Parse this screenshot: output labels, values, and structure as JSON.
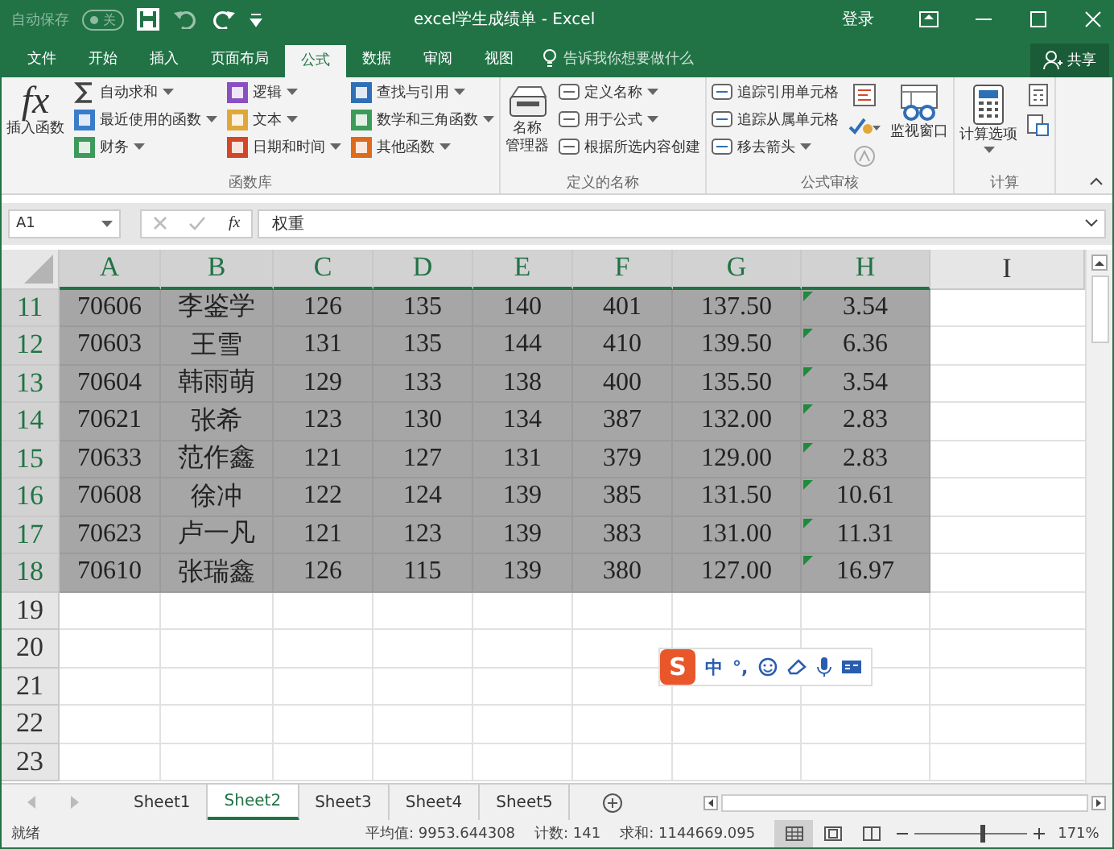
{
  "title_bar": {
    "autosave": {
      "label": "自动保存",
      "state": "关",
      "on": false
    },
    "title": "excel学生成绩单  -  Excel",
    "login": "登录"
  },
  "menu_tabs": [
    {
      "label": "文件",
      "selected": false
    },
    {
      "label": "开始",
      "selected": false
    },
    {
      "label": "插入",
      "selected": false
    },
    {
      "label": "页面布局",
      "selected": false
    },
    {
      "label": "公式",
      "selected": true
    },
    {
      "label": "数据",
      "selected": false
    },
    {
      "label": "审阅",
      "selected": false
    },
    {
      "label": "视图",
      "selected": false
    }
  ],
  "tell_me": {
    "placeholder": "告诉我你想要做什么"
  },
  "share": "共享",
  "ribbon": {
    "groups": [
      {
        "label": "函数库",
        "big": {
          "glyph": "fx",
          "label": "插入函数"
        },
        "columns": [
          [
            {
              "label": "自动求和",
              "dropdown": true
            },
            {
              "label": "最近使用的函数",
              "dropdown": true
            },
            {
              "label": "财务",
              "dropdown": true
            }
          ],
          [
            {
              "label": "逻辑",
              "dropdown": true
            },
            {
              "label": "文本",
              "dropdown": true
            },
            {
              "label": "日期和时间",
              "dropdown": true
            }
          ],
          [
            {
              "label": "查找与引用",
              "dropdown": true
            },
            {
              "label": "数学和三角函数",
              "dropdown": true
            },
            {
              "label": "其他函数",
              "dropdown": true
            }
          ]
        ]
      },
      {
        "label": "定义的名称",
        "big": {
          "label_lines": [
            "名称",
            "管理器"
          ]
        },
        "columns": [
          [
            {
              "label": "定义名称",
              "dropdown": true
            },
            {
              "label": "用于公式",
              "dropdown": true
            },
            {
              "label": "根据所选内容创建",
              "dropdown": false
            }
          ]
        ]
      },
      {
        "label": "公式审核",
        "columns": [
          [
            {
              "label": "追踪引用单元格",
              "dropdown": false
            },
            {
              "label": "追踪从属单元格",
              "dropdown": false
            },
            {
              "label": "移去箭头",
              "dropdown": true
            }
          ]
        ],
        "after": {
          "label": "监视窗口",
          "dropdown": false
        }
      },
      {
        "label": "计算",
        "after": {
          "label": "计算选项",
          "dropdown": true
        }
      }
    ]
  },
  "name_box": "A1",
  "formula_bar": {
    "glyph": "fx",
    "value": "权重"
  },
  "columns": [
    {
      "label": "A",
      "selected": true
    },
    {
      "label": "B",
      "selected": true
    },
    {
      "label": "C",
      "selected": true
    },
    {
      "label": "D",
      "selected": true
    },
    {
      "label": "E",
      "selected": true
    },
    {
      "label": "F",
      "selected": true
    },
    {
      "label": "G",
      "selected": true
    },
    {
      "label": "H",
      "selected": true
    },
    {
      "label": "I",
      "selected": false
    }
  ],
  "rows": [
    {
      "number": "11",
      "selected": true,
      "cells": [
        "70606",
        "李鉴学",
        "126",
        "135",
        "140",
        "401",
        "137.50",
        "3.54"
      ],
      "h_warning": true
    },
    {
      "number": "12",
      "selected": true,
      "cells": [
        "70603",
        "王雪",
        "131",
        "135",
        "144",
        "410",
        "139.50",
        "6.36"
      ],
      "h_warning": true
    },
    {
      "number": "13",
      "selected": true,
      "cells": [
        "70604",
        "韩雨萌",
        "129",
        "133",
        "138",
        "400",
        "135.50",
        "3.54"
      ],
      "h_warning": true
    },
    {
      "number": "14",
      "selected": true,
      "cells": [
        "70621",
        "张希",
        "123",
        "130",
        "134",
        "387",
        "132.00",
        "2.83"
      ],
      "h_warning": true
    },
    {
      "number": "15",
      "selected": true,
      "cells": [
        "70633",
        "范作鑫",
        "121",
        "127",
        "131",
        "379",
        "129.00",
        "2.83"
      ],
      "h_warning": true
    },
    {
      "number": "16",
      "selected": true,
      "cells": [
        "70608",
        "徐冲",
        "122",
        "124",
        "139",
        "385",
        "131.50",
        "10.61"
      ],
      "h_warning": true
    },
    {
      "number": "17",
      "selected": true,
      "cells": [
        "70623",
        "卢一凡",
        "121",
        "123",
        "139",
        "383",
        "131.00",
        "11.31"
      ],
      "h_warning": true
    },
    {
      "number": "18",
      "selected": true,
      "cells": [
        "70610",
        "张瑞鑫",
        "126",
        "115",
        "139",
        "380",
        "127.00",
        "16.97"
      ],
      "h_warning": true
    },
    {
      "number": "19",
      "selected": false,
      "cells": [],
      "h_warning": false
    },
    {
      "number": "20",
      "selected": false,
      "cells": [],
      "h_warning": false
    },
    {
      "number": "21",
      "selected": false,
      "cells": [],
      "h_warning": false
    },
    {
      "number": "22",
      "selected": false,
      "cells": [],
      "h_warning": false
    },
    {
      "number": "23",
      "selected": false,
      "cells": [],
      "h_warning": false
    }
  ],
  "ime_bar": {
    "logo": "S",
    "mode": "中",
    "punct": "°,"
  },
  "sheets": [
    {
      "label": "Sheet1",
      "selected": false
    },
    {
      "label": "Sheet2",
      "selected": true
    },
    {
      "label": "Sheet3",
      "selected": false
    },
    {
      "label": "Sheet4",
      "selected": false
    },
    {
      "label": "Sheet5",
      "selected": false
    }
  ],
  "status_bar": {
    "state": "就绪",
    "average": "平均值: 9953.644308",
    "count": "计数: 141",
    "sum": "求和: 1144669.095",
    "zoom": {
      "level": 0.6,
      "reading": "171%"
    }
  }
}
